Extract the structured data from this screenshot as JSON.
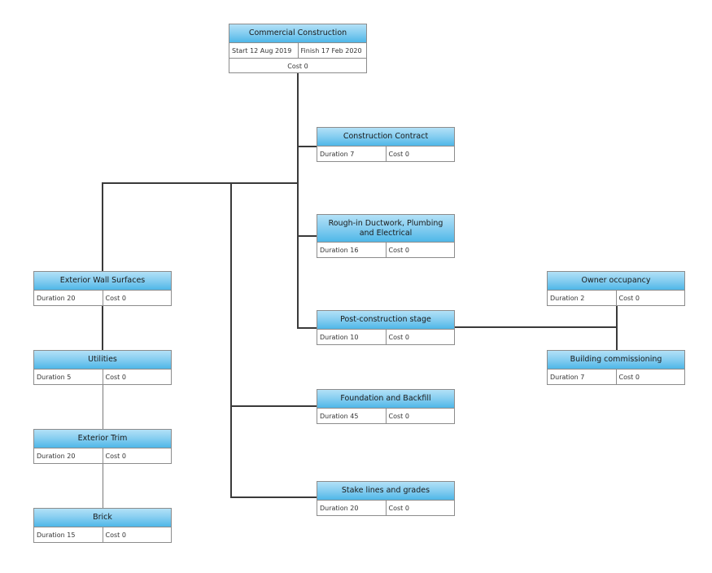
{
  "diagram": {
    "type": "work-breakdown-structure",
    "root": {
      "title": "Commercial Construction",
      "start": "Start 12 Aug 2019",
      "finish": "Finish 17 Feb 2020",
      "cost": "Cost 0"
    },
    "nodes": {
      "construction_contract": {
        "title": "Construction Contract",
        "duration": "Duration 7",
        "cost": "Cost 0"
      },
      "rough_in": {
        "title": "Rough-in Ductwork, Plumbing and Electrical",
        "duration": "Duration 16",
        "cost": "Cost 0"
      },
      "post_construction": {
        "title": "Post-construction stage",
        "duration": "Duration 10",
        "cost": "Cost 0"
      },
      "foundation": {
        "title": "Foundation and Backfill",
        "duration": "Duration 45",
        "cost": "Cost 0"
      },
      "stake_lines": {
        "title": "Stake lines and grades",
        "duration": "Duration 20",
        "cost": "Cost 0"
      },
      "exterior_wall": {
        "title": "Exterior Wall Surfaces",
        "duration": "Duration 20",
        "cost": "Cost 0"
      },
      "utilities": {
        "title": "Utilities",
        "duration": "Duration 5",
        "cost": "Cost 0"
      },
      "exterior_trim": {
        "title": "Exterior Trim",
        "duration": "Duration 20",
        "cost": "Cost 0"
      },
      "brick": {
        "title": "Brick",
        "duration": "Duration 15",
        "cost": "Cost 0"
      },
      "owner_occupancy": {
        "title": "Owner occupancy",
        "duration": "Duration 2",
        "cost": "Cost 0"
      },
      "building_commissioning": {
        "title": "Building commissioning",
        "duration": "Duration 7",
        "cost": "Cost 0"
      }
    },
    "edges": [
      [
        "root",
        "construction_contract"
      ],
      [
        "root",
        "rough_in"
      ],
      [
        "root",
        "post_construction"
      ],
      [
        "root",
        "exterior_wall"
      ],
      [
        "root",
        "foundation"
      ],
      [
        "root",
        "stake_lines"
      ],
      [
        "post_construction",
        "owner_occupancy"
      ],
      [
        "post_construction",
        "building_commissioning"
      ],
      [
        "exterior_wall",
        "utilities"
      ],
      [
        "utilities",
        "exterior_trim"
      ],
      [
        "exterior_trim",
        "brick"
      ]
    ],
    "colors": {
      "header_top": "#b3e1f7",
      "header_bottom": "#4fb7e8",
      "border": "#8c8c8c",
      "connector": "#3a3a3a"
    }
  }
}
